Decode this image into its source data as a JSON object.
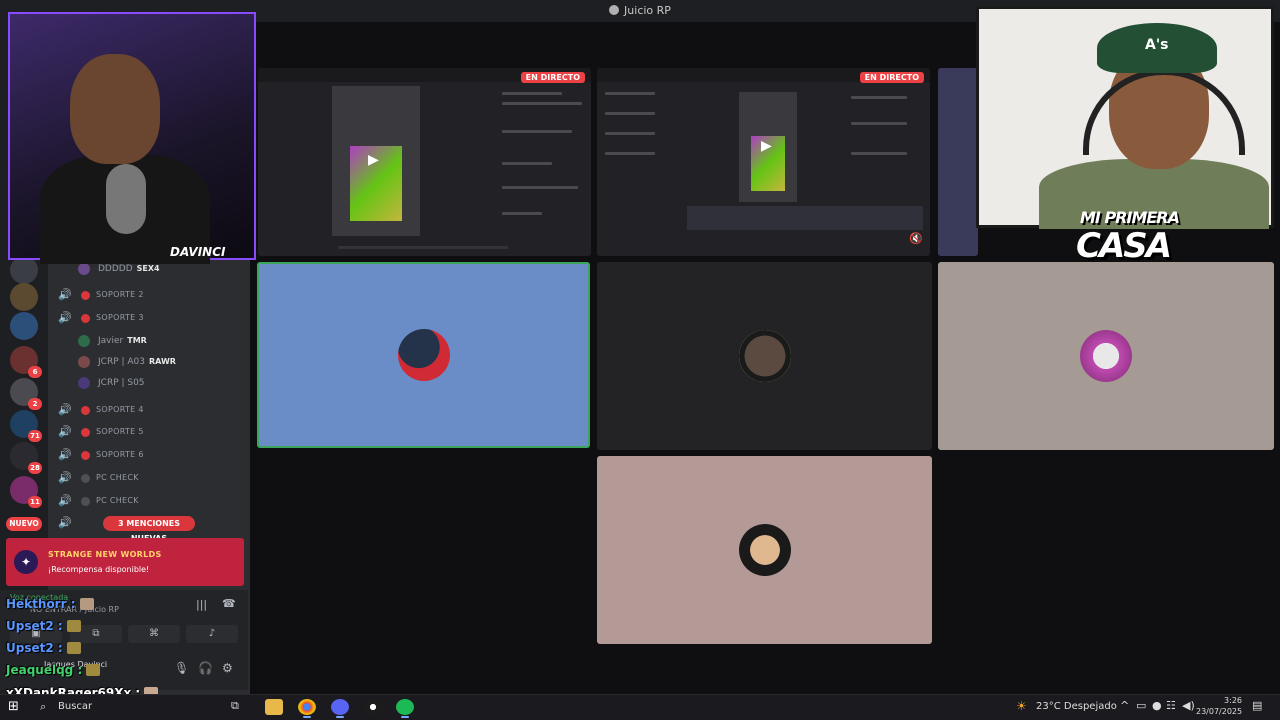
{
  "window": {
    "title": "Juicio RP"
  },
  "server_rail": {
    "badges": [
      "6",
      "2",
      "71",
      "28",
      "11"
    ],
    "new_label": "NUEVO"
  },
  "channels": {
    "top_user": {
      "name": "DDDDD",
      "tag": "SEX4"
    },
    "rows_a": [
      {
        "label": "SOPORTE 2"
      },
      {
        "label": "SOPORTE 3"
      }
    ],
    "users": [
      {
        "name": "Javier",
        "tag": "TMR"
      },
      {
        "name": "JCRP | A03",
        "tag": "RAWR"
      },
      {
        "name": "JCRP | S05",
        "tag": ""
      }
    ],
    "rows_b": [
      {
        "label": "SOPORTE 4"
      },
      {
        "label": "SOPORTE 5"
      },
      {
        "label": "SOPORTE 6"
      },
      {
        "label": "PC CHECK"
      },
      {
        "label": "PC CHECK"
      }
    ],
    "mentions_label": "3 MENCIONES NUEVAS"
  },
  "promo": {
    "title": "STRANGE NEW WORLDS",
    "subtitle": "¡Recompensa disponible!"
  },
  "voice": {
    "status": "Voz conectada",
    "channel": "NO ENTRAR / Juicio RP",
    "self_name": "Jacques Davinci"
  },
  "chat": [
    {
      "user": "Hekthorr :"
    },
    {
      "user": "Upset2 :"
    },
    {
      "user": "Upset2 :"
    },
    {
      "user": "Jeaquelqg :"
    },
    {
      "user": "xXDankRager69Xx :"
    }
  ],
  "stage": {
    "live_badge": "EN DIRECTO",
    "colors": {
      "tile_blue": "#6a8dc8",
      "tile_dark": "#232326",
      "tile_taupe": "#a69b94",
      "tile_pink": "#b49a96",
      "active_border": "#3ba55c"
    }
  },
  "webcams": {
    "left_name": "DAVINCI",
    "right_logo_top": "MI PRIMERA",
    "right_logo_bottom": "CASA",
    "cap_letter": "A's"
  },
  "taskbar": {
    "search_label": "Buscar",
    "weather": "23°C  Despejado",
    "time": "3:26",
    "date": "23/07/2025"
  }
}
